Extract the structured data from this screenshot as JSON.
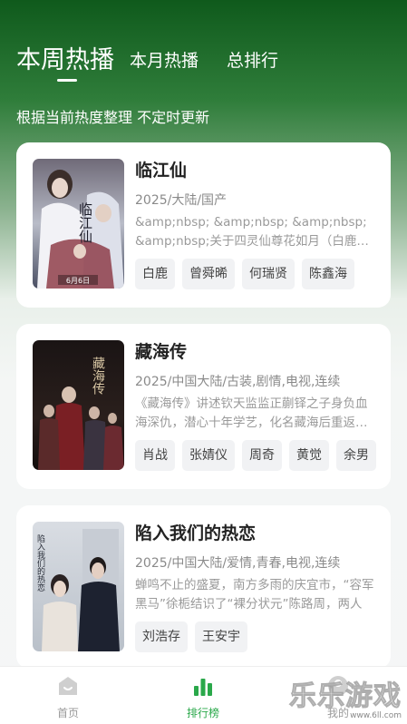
{
  "tabs": [
    {
      "label": "本周热播",
      "active": true
    },
    {
      "label": "本月热播",
      "active": false
    },
    {
      "label": "总排行",
      "active": false
    }
  ],
  "subtitle": "根据当前热度整理 不定时更新",
  "cards": [
    {
      "title": "临江仙",
      "meta": "2025/大陆/国产",
      "desc": "&amp;nbsp; &amp;nbsp; &amp;nbsp; &amp;nbsp;关于四灵仙尊花如月（白鹿饰）的故事",
      "cast": [
        "白鹿",
        "曾舜晞",
        "何瑞贤",
        "陈鑫海"
      ],
      "poster_text": "临江仙",
      "poster_date": "6月6日"
    },
    {
      "title": "藏海传",
      "meta": "2025/中国大陆/古装,剧情,电视,连续",
      "desc": "《藏海传》讲述钦天监监正蒯铎之子身负血海深仇，潜心十年学艺，化名藏海后重返京城",
      "cast": [
        "肖战",
        "张婧仪",
        "周奇",
        "黄觉",
        "余男"
      ],
      "poster_text": "藏海传"
    },
    {
      "title": "陷入我们的热恋",
      "meta": "2025/中国大陆/爱情,青春,电视,连续",
      "desc": "蝉鸣不止的盛夏，南方多雨的庆宜市，“容军黑马”徐栀结识了“裸分状元”陈路周，两人",
      "cast": [
        "刘浩存",
        "王安宇"
      ],
      "poster_text": "陷入我们的热恋"
    }
  ],
  "bottom_nav": [
    {
      "label": "首页",
      "icon": "home-icon",
      "active": false
    },
    {
      "label": "排行榜",
      "icon": "rank-bars-icon",
      "active": true
    },
    {
      "label": "我的",
      "icon": "user-icon",
      "active": false
    }
  ],
  "watermark": {
    "text": "乐乐游戏",
    "url": "www.6ll.com"
  },
  "colors": {
    "accent": "#2aa84a",
    "header_green": "#1e6b2a"
  }
}
